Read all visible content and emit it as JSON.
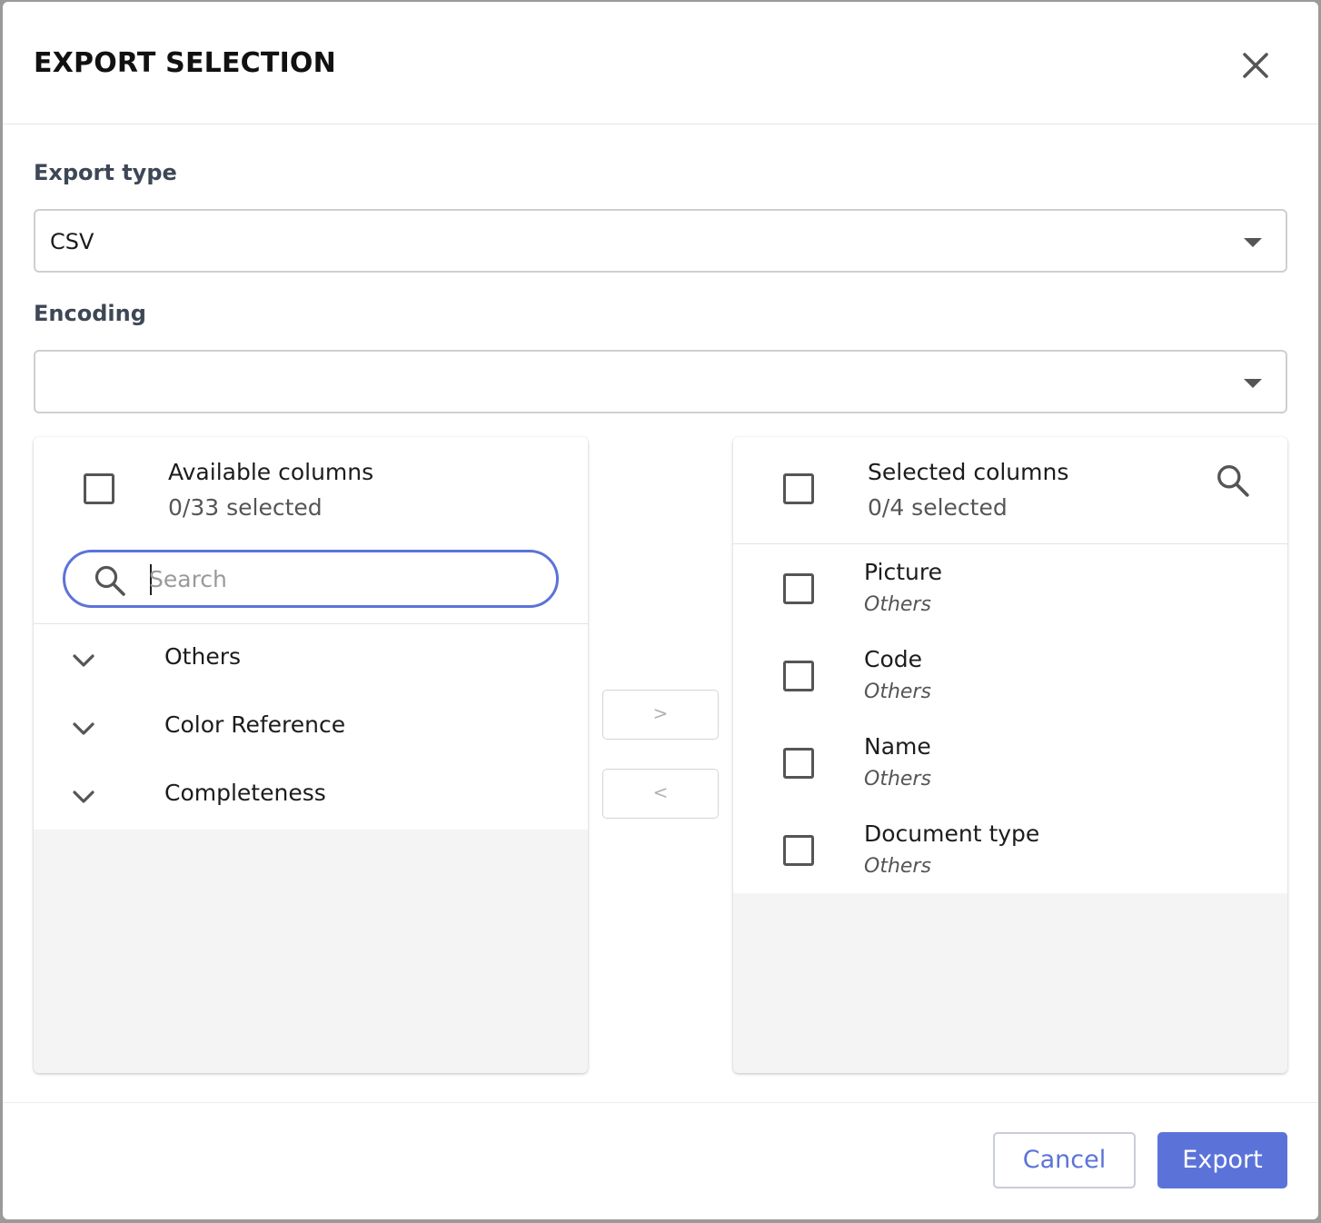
{
  "dialog": {
    "title": "EXPORT SELECTION",
    "close_icon": "close-icon"
  },
  "export_type": {
    "label": "Export type",
    "value": "CSV"
  },
  "encoding": {
    "label": "Encoding",
    "value": ""
  },
  "available": {
    "title": "Available columns",
    "count": "0/33 selected",
    "search_placeholder": "Search",
    "groups": [
      {
        "label": "Others"
      },
      {
        "label": "Color Reference"
      },
      {
        "label": "Completeness"
      }
    ]
  },
  "move": {
    "right_label": ">",
    "left_label": "<"
  },
  "selected": {
    "title": "Selected columns",
    "count": "0/4 selected",
    "columns": [
      {
        "name": "Picture",
        "group": "Others"
      },
      {
        "name": "Code",
        "group": "Others"
      },
      {
        "name": "Name",
        "group": "Others"
      },
      {
        "name": "Document type",
        "group": "Others"
      }
    ]
  },
  "footer": {
    "cancel_label": "Cancel",
    "export_label": "Export"
  },
  "colors": {
    "accent": "#5b73d9",
    "panel_bg": "#f4f4f4",
    "text": "#1c1c1c"
  }
}
